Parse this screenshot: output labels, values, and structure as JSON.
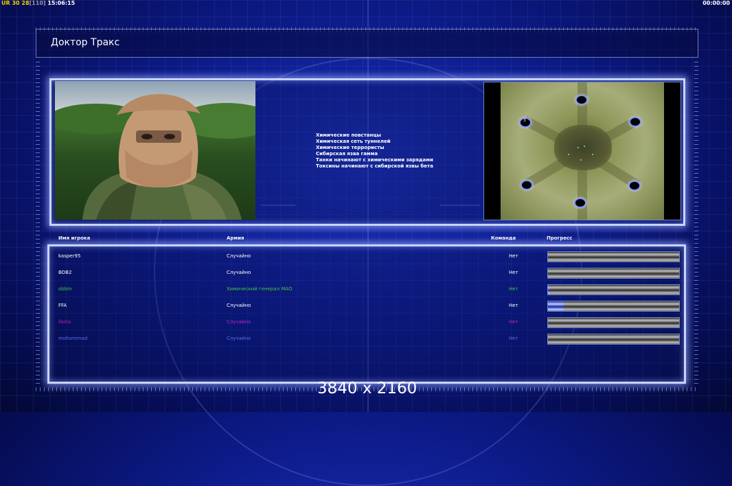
{
  "hud": {
    "tag": "UR",
    "fps": "30",
    "frames": "28",
    "bracket": "[110]",
    "clock": "15:06:15",
    "timer": "00:00:00"
  },
  "window_title": "Доктор Тракс",
  "general_traits": [
    "Химические повстанцы",
    "Химическая сеть туннелей",
    "Химические террористы",
    "Сибирская язва гамма",
    "Танки начинают с химическими зарядами",
    "Токсины начинают с сибирской язвы бета"
  ],
  "minimap": {
    "start_marker": "3"
  },
  "columns": {
    "player": "Имя игрока",
    "army": "Армия",
    "team": "Команда",
    "progress": "Прогресс"
  },
  "players": [
    {
      "name": "kasper95",
      "army": "Случайно",
      "team": "Нет",
      "color": "#ffffff",
      "progress": 0.0
    },
    {
      "name": "BOB2",
      "army": "Случайно",
      "team": "Нет",
      "color": "#ffffff",
      "progress": 0.0
    },
    {
      "name": "obbin",
      "army": "Химический генерал МАО",
      "team": "Нет",
      "color": "#3ec83e",
      "progress": 0.01
    },
    {
      "name": "FFA",
      "army": "Случайно",
      "team": "Нет",
      "color": "#ffffff",
      "progress": 0.12
    },
    {
      "name": "ilsina",
      "army": "Случайно",
      "team": "Нет",
      "color": "#c020c0",
      "progress": 0.0
    },
    {
      "name": "mohammad",
      "army": "Случайно",
      "team": "Нет",
      "color": "#5d6cf0",
      "progress": 0.0
    }
  ],
  "watermark": "3840 x 2160"
}
